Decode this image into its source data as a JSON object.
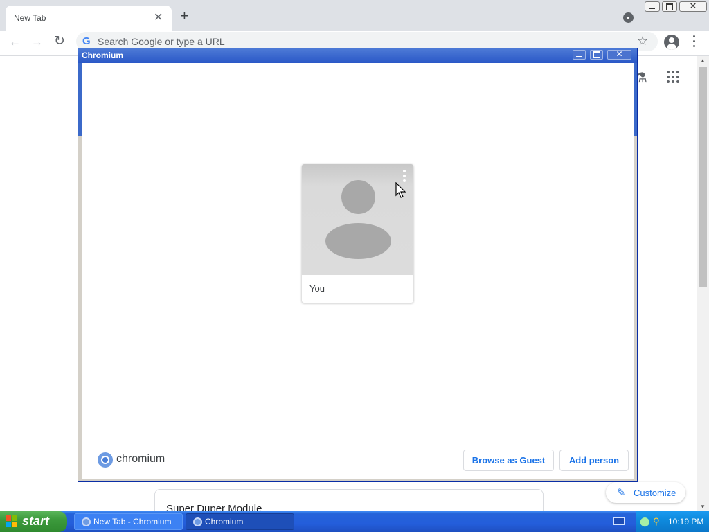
{
  "browser": {
    "tab_title": "New Tab",
    "tab_close_glyph": "✕",
    "new_tab_glyph": "+",
    "omnibox_placeholder": "Search Google or type a URL",
    "google_glyph": "G",
    "back_glyph": "←",
    "forward_glyph": "→",
    "reload_glyph": "↻",
    "star_glyph": "☆",
    "window_close_glyph": "✕"
  },
  "ntp": {
    "module_title": "Super Duper Module",
    "customize_label": "Customize",
    "customize_glyph": "✎",
    "labs_glyph": "⚗",
    "scroll_up_glyph": "▲",
    "scroll_down_glyph": "▼"
  },
  "dialog": {
    "title": "Chromium",
    "close_glyph": "✕",
    "profile_name": "You",
    "brand_wordmark": "chromium",
    "guest_button": "Browse as Guest",
    "add_person_button": "Add person"
  },
  "taskbar": {
    "start_label": "start",
    "tasks": [
      {
        "label": "New Tab - Chromium"
      },
      {
        "label": "Chromium"
      }
    ],
    "clock": "10:19 PM"
  },
  "colors": {
    "accent_blue": "#1a73e8",
    "xp_titlebar": "#2a58c7",
    "xp_taskbar": "#245edb",
    "avatar_gray": "#a8a8a8"
  },
  "icons": [
    "back-icon",
    "forward-icon",
    "reload-icon",
    "google-icon",
    "star-icon",
    "profile-icon",
    "menu-icon",
    "labs-icon",
    "apps-icon",
    "pencil-icon",
    "chromium-logo-icon",
    "kebab-icon",
    "windows-flag-icon",
    "keyboard-icon"
  ]
}
